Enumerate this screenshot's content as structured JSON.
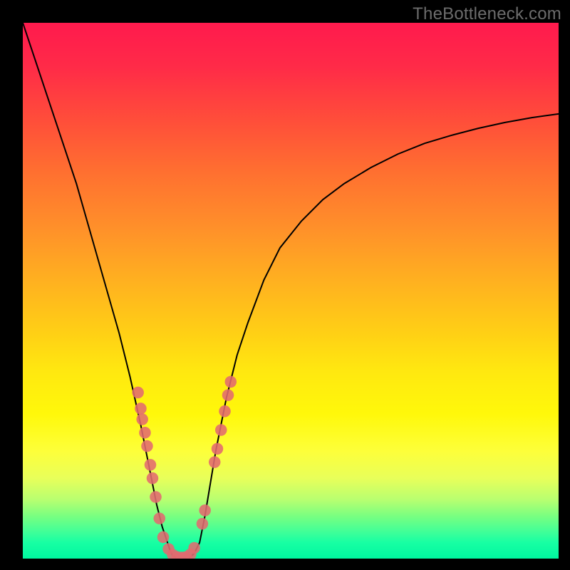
{
  "watermark": "TheBottleneck.com",
  "chart_data": {
    "type": "line",
    "title": "",
    "xlabel": "",
    "ylabel": "",
    "xlim": [
      0,
      100
    ],
    "ylim": [
      0,
      100
    ],
    "grid": false,
    "series": [
      {
        "name": "curve",
        "color": "#000000",
        "x": [
          0,
          2,
          4,
          6,
          8,
          10,
          12,
          14,
          16,
          18,
          20,
          22,
          24,
          25,
          26,
          27,
          27.5,
          28,
          29,
          30,
          31,
          32,
          33,
          34,
          35,
          36,
          38,
          40,
          42,
          45,
          48,
          52,
          56,
          60,
          65,
          70,
          75,
          80,
          85,
          90,
          95,
          100
        ],
        "y": [
          100,
          94,
          88,
          82,
          76,
          70,
          63,
          56,
          49,
          42,
          34,
          25,
          15,
          10,
          6,
          3,
          1.5,
          0.5,
          0,
          0,
          0,
          1,
          3,
          8,
          14,
          20,
          30,
          38,
          44,
          52,
          58,
          63,
          67,
          70,
          73,
          75.5,
          77.5,
          79,
          80.3,
          81.4,
          82.3,
          83
        ]
      }
    ],
    "markers": {
      "color": "#e36a6f",
      "radius_frac": 0.011,
      "points": [
        {
          "x": 21.5,
          "y": 31
        },
        {
          "x": 22.0,
          "y": 28
        },
        {
          "x": 22.3,
          "y": 26
        },
        {
          "x": 22.8,
          "y": 23.5
        },
        {
          "x": 23.2,
          "y": 21
        },
        {
          "x": 23.8,
          "y": 17.5
        },
        {
          "x": 24.2,
          "y": 15
        },
        {
          "x": 24.8,
          "y": 11.5
        },
        {
          "x": 25.5,
          "y": 7.5
        },
        {
          "x": 26.2,
          "y": 4
        },
        {
          "x": 27.2,
          "y": 1.8
        },
        {
          "x": 28.0,
          "y": 0.7
        },
        {
          "x": 28.8,
          "y": 0.3
        },
        {
          "x": 29.7,
          "y": 0.2
        },
        {
          "x": 30.5,
          "y": 0.3
        },
        {
          "x": 31.3,
          "y": 0.8
        },
        {
          "x": 32.0,
          "y": 2.0
        },
        {
          "x": 33.5,
          "y": 6.5
        },
        {
          "x": 34.0,
          "y": 9
        },
        {
          "x": 35.8,
          "y": 18
        },
        {
          "x": 36.3,
          "y": 20.5
        },
        {
          "x": 37.0,
          "y": 24
        },
        {
          "x": 37.7,
          "y": 27.5
        },
        {
          "x": 38.3,
          "y": 30.5
        },
        {
          "x": 38.8,
          "y": 33
        }
      ]
    },
    "background_gradient": {
      "top": "#ff1a4d",
      "bottom": "#00f7a0"
    }
  }
}
